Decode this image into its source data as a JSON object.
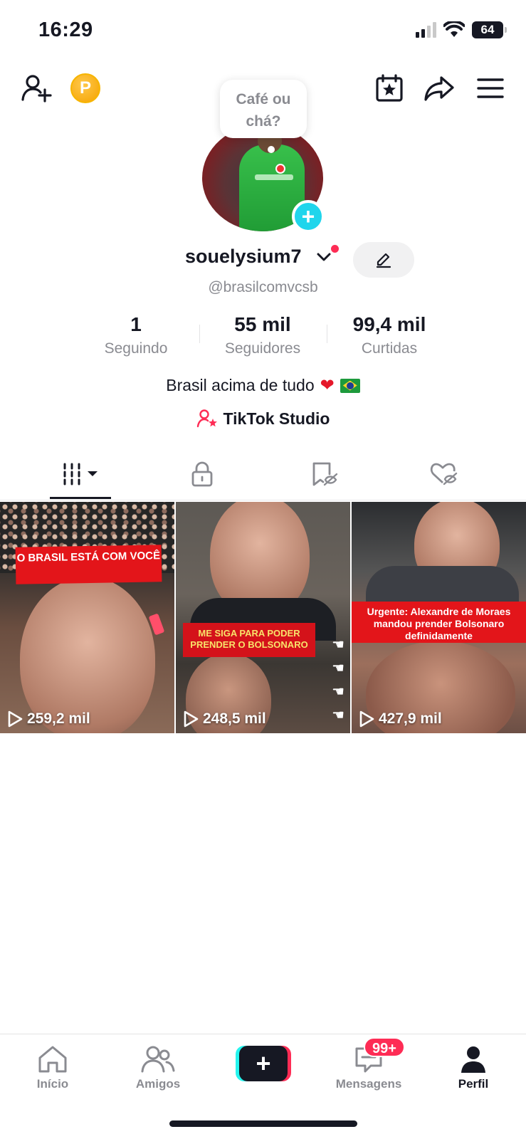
{
  "status_bar": {
    "time": "16:29",
    "battery": "64"
  },
  "top_bar": {
    "coin_letter": "P"
  },
  "profile": {
    "bubble_text": "Café ou chá?",
    "username": "souelysium7",
    "handle": "@brasilcomvcsb",
    "stats": [
      {
        "value": "1",
        "label": "Seguindo"
      },
      {
        "value": "55 mil",
        "label": "Seguidores"
      },
      {
        "value": "99,4 mil",
        "label": "Curtidas"
      }
    ],
    "bio": "Brasil acima de tudo",
    "studio_label": "TikTok Studio"
  },
  "tabs": [
    {
      "icon": "videos-grid-icon",
      "active": true
    },
    {
      "icon": "lock-icon",
      "active": false
    },
    {
      "icon": "bookmark-hidden-icon",
      "active": false
    },
    {
      "icon": "liked-hidden-icon",
      "active": false
    }
  ],
  "videos": [
    {
      "caption": "O BRASIL ESTÁ COM VOCÊ",
      "views": "259,2 mil"
    },
    {
      "caption": "ME SIGA PARA PODER PRENDER O BOLSONARO",
      "views": "248,5 mil"
    },
    {
      "caption": "Urgente: Alexandre de Moraes mandou prender Bolsonaro definidamente",
      "views": "427,9 mil"
    }
  ],
  "bottom_nav": {
    "items": [
      {
        "label": "Início",
        "icon": "home-icon"
      },
      {
        "label": "Amigos",
        "icon": "friends-icon"
      },
      {
        "label": "",
        "icon": "create-icon"
      },
      {
        "label": "Mensagens",
        "icon": "inbox-icon",
        "badge": "99+"
      },
      {
        "label": "Perfil",
        "icon": "profile-icon",
        "active": true
      }
    ]
  },
  "colors": {
    "accent": "#fe2c55",
    "cyan": "#25f4ee",
    "text": "#161823",
    "muted": "#8a8b91"
  }
}
